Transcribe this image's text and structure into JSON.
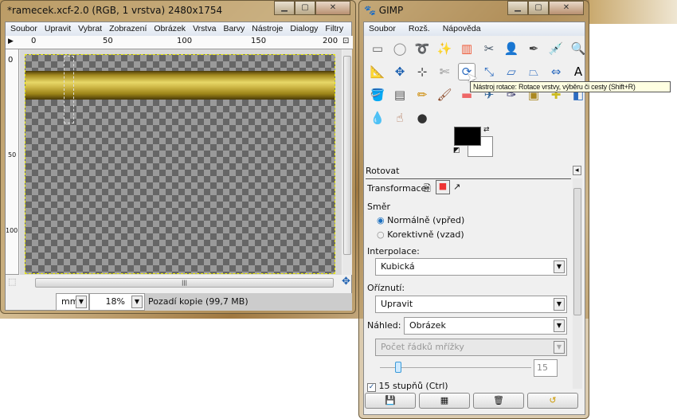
{
  "image_window": {
    "title": "*ramecek.xcf-2.0 (RGB, 1 vrstva) 2480x1754",
    "menu": [
      "Soubor",
      "Upravit",
      "Vybrat",
      "Zobrazení",
      "Obrázek",
      "Vrstva",
      "Barvy",
      "Nástroje",
      "Dialogy",
      "Filtry"
    ],
    "ruler_h": [
      "0",
      "50",
      "100",
      "150",
      "200"
    ],
    "ruler_v": [
      "0",
      "50",
      "100"
    ],
    "unit": "mm",
    "zoom": "18%",
    "status": "Pozadí kopie (99,7 MB)"
  },
  "toolbox": {
    "title": "GIMP",
    "menu": [
      "Soubor",
      "Rozš.",
      "Nápověda"
    ],
    "tools": [
      {
        "icon": "rect-select-icon",
        "g": "▭"
      },
      {
        "icon": "ellipse-select-icon",
        "g": "◯"
      },
      {
        "icon": "lasso-icon",
        "g": "➰"
      },
      {
        "icon": "fuzzy-select-icon",
        "g": "✨"
      },
      {
        "icon": "color-select-icon",
        "g": "▥"
      },
      {
        "icon": "scissors-icon",
        "g": "✂"
      },
      {
        "icon": "foreground-select-icon",
        "g": "👤"
      },
      {
        "icon": "paths-icon",
        "g": "✒"
      },
      {
        "icon": "color-picker-icon",
        "g": "💉"
      },
      {
        "icon": "zoom-icon",
        "g": "🔍"
      },
      {
        "icon": "measure-icon",
        "g": "📐"
      },
      {
        "icon": "move-icon",
        "g": "✥"
      },
      {
        "icon": "align-icon",
        "g": "⊹"
      },
      {
        "icon": "crop-icon",
        "g": "✄"
      },
      {
        "icon": "rotate-icon",
        "g": "⟳"
      },
      {
        "icon": "scale-icon",
        "g": "⤡"
      },
      {
        "icon": "shear-icon",
        "g": "▱"
      },
      {
        "icon": "perspective-icon",
        "g": "⏢"
      },
      {
        "icon": "flip-icon",
        "g": "⇔"
      },
      {
        "icon": "text-icon",
        "g": "A"
      },
      {
        "icon": "bucket-fill-icon",
        "g": "🪣"
      },
      {
        "icon": "blend-icon",
        "g": "▤"
      },
      {
        "icon": "pencil-icon",
        "g": "✏"
      },
      {
        "icon": "paintbrush-icon",
        "g": "🖌"
      },
      {
        "icon": "eraser-icon",
        "g": "▬"
      },
      {
        "icon": "airbrush-icon",
        "g": "✈"
      },
      {
        "icon": "ink-icon",
        "g": "✑"
      },
      {
        "icon": "clone-icon",
        "g": "▣"
      },
      {
        "icon": "heal-icon",
        "g": "✚"
      },
      {
        "icon": "perspective-clone-icon",
        "g": "◧"
      },
      {
        "icon": "blur-icon",
        "g": "💧"
      },
      {
        "icon": "smudge-icon",
        "g": "☝"
      },
      {
        "icon": "dodge-burn-icon",
        "g": "●"
      }
    ],
    "tooltip": "Nástroj rotace: Rotace vrstvy, výběru či cesty  (Shift+R)",
    "colors": {
      "fg": "#000000",
      "bg": "#ffffff"
    }
  },
  "options": {
    "title": "Rotovat",
    "transform_label": "Transformace:",
    "direction_label": "Směr",
    "direction_options": [
      "Normálně (vpřed)",
      "Korektivně (vzad)"
    ],
    "direction_selected": 0,
    "interp_label": "Interpolace:",
    "interp_value": "Kubická",
    "clip_label": "Oříznutí:",
    "clip_value": "Upravit",
    "preview_label": "Náhled:",
    "preview_value": "Obrázek",
    "grid_value": "Počet řádků mřížky",
    "grid_lines": "15",
    "constrain_label": "15 stupňů  (Ctrl)",
    "constrain_checked": true
  }
}
